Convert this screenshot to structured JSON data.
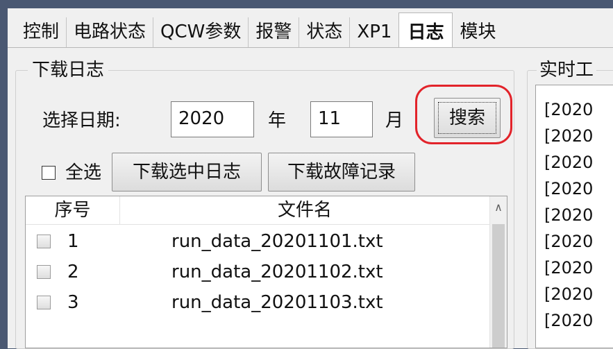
{
  "tabs": [
    {
      "label": "控制"
    },
    {
      "label": "电路状态"
    },
    {
      "label": "QCW参数"
    },
    {
      "label": "报警"
    },
    {
      "label": "状态"
    },
    {
      "label": "XP1"
    },
    {
      "label": "日志",
      "active": true
    },
    {
      "label": "模块"
    }
  ],
  "download_log": {
    "title": "下载日志",
    "date_label": "选择日期:",
    "year_value": "2020",
    "year_unit": "年",
    "month_value": "11",
    "month_unit": "月",
    "search_button": "搜索",
    "select_all_label": "全选",
    "select_all_checked": false,
    "download_selected_button": "下载选中日志",
    "download_fault_button": "下载故障记录"
  },
  "file_list": {
    "columns": [
      "序号",
      "文件名"
    ],
    "rows": [
      {
        "index": "1",
        "filename": "run_data_20201101.txt",
        "checked": false
      },
      {
        "index": "2",
        "filename": "run_data_20201102.txt",
        "checked": false
      },
      {
        "index": "3",
        "filename": "run_data_20201103.txt",
        "checked": false
      }
    ]
  },
  "realtime_log": {
    "title": "实时工",
    "lines": [
      "[2020",
      "[2020",
      "[2020",
      "[2020",
      "[2020",
      "[2020",
      "[2020",
      "[2020",
      "[2020"
    ]
  },
  "colors": {
    "highlight": "#e2232a",
    "window_bg": "#f0f0f0",
    "desktop_bg": "#4a5872"
  }
}
